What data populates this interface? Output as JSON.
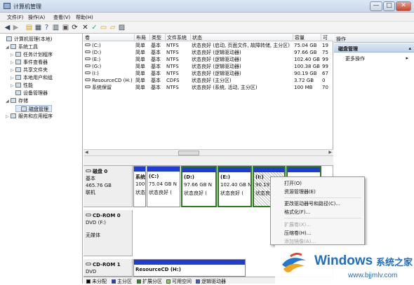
{
  "window": {
    "title": "计算机管理",
    "min": "—",
    "max": "□",
    "close": "✕"
  },
  "menu": [
    "文件(F)",
    "操作(A)",
    "查看(V)",
    "帮助(H)"
  ],
  "tree": [
    {
      "label": "计算机管理(本地)",
      "toggle": ""
    },
    {
      "label": "系统工具",
      "toggle": "◢"
    },
    {
      "label": "任务计划程序",
      "toggle": "▷"
    },
    {
      "label": "事件查看器",
      "toggle": "▷"
    },
    {
      "label": "共享文件夹",
      "toggle": "▷"
    },
    {
      "label": "本地用户和组",
      "toggle": "▷"
    },
    {
      "label": "性能",
      "toggle": "▷"
    },
    {
      "label": "设备管理器",
      "toggle": ""
    },
    {
      "label": "存储",
      "toggle": "◢"
    },
    {
      "label": "磁盘管理",
      "toggle": ""
    },
    {
      "label": "服务和应用程序",
      "toggle": "▷"
    }
  ],
  "volumes": {
    "headers": [
      "卷",
      "布局",
      "类型",
      "文件系统",
      "状态",
      "容量",
      "可"
    ],
    "rows": [
      [
        "(C:)",
        "简单",
        "基本",
        "NTFS",
        "状态良好 (启动, 页面文件, 故障转储, 主分区)",
        "75.04 GB",
        "19"
      ],
      [
        "(D:)",
        "简单",
        "基本",
        "NTFS",
        "状态良好 (逻辑驱动器)",
        "97.66 GB",
        "75"
      ],
      [
        "(E:)",
        "简单",
        "基本",
        "NTFS",
        "状态良好 (逻辑驱动器)",
        "102.40 GB",
        "99"
      ],
      [
        "(G:)",
        "简单",
        "基本",
        "NTFS",
        "状态良好 (逻辑驱动器)",
        "100.38 GB",
        "99"
      ],
      [
        "(I:)",
        "简单",
        "基本",
        "NTFS",
        "状态良好 (逻辑驱动器)",
        "90.19 GB",
        "67"
      ],
      [
        "ResourceCD (H:)",
        "简单",
        "基本",
        "CDFS",
        "状态良好 (主分区)",
        "3.72 GB",
        "0"
      ],
      [
        "系统保留",
        "简单",
        "基本",
        "NTFS",
        "状态良好 (系统, 活动, 主分区)",
        "100 MB",
        "70"
      ]
    ]
  },
  "disk0": {
    "title": "磁盘 0",
    "type": "基本",
    "size": "465.76 GB",
    "status": "联机",
    "parts": [
      {
        "name": "系统",
        "size": "100",
        "state": "状态"
      },
      {
        "name": "(C:)",
        "size": "75.04 GB N",
        "state": "状态良好 ("
      },
      {
        "name": "(D:)",
        "size": "97.66 GB N",
        "state": "状态良好 ("
      },
      {
        "name": "(E:)",
        "size": "102.40 GB N",
        "state": "状态良好 ("
      },
      {
        "name": "(I:)",
        "size": "90.19",
        "state": "状态良"
      },
      {
        "name": "",
        "size": "",
        "state": ""
      }
    ]
  },
  "cdrom0": {
    "title": "CD-ROM 0",
    "line1": "DVD (F:)",
    "line2": "",
    "line3": "无媒体"
  },
  "cdrom1": {
    "title": "CD-ROM 1",
    "line1": "DVD",
    "part_name": "ResourceCD (H:)"
  },
  "legend": [
    "未分配",
    "主分区",
    "扩展分区",
    "可用空间",
    "逻辑驱动器"
  ],
  "legend_colors": [
    "#000000",
    "#1e3cd6",
    "#2e8b22",
    "#8fd14f",
    "#3a5bd9"
  ],
  "actions": {
    "header": "操作",
    "section": "磁盘管理",
    "more": "更多操作",
    "more_arrow": "▸",
    "section_arrow": "▴"
  },
  "context_menu": [
    {
      "label": "打开(O)",
      "disabled": false
    },
    {
      "label": "资源管理器(E)",
      "disabled": false
    },
    {
      "label": "更改驱动器号和路径(C)...",
      "disabled": false
    },
    {
      "label": "格式化(F)...",
      "disabled": false
    },
    {
      "label": "扩展卷(X)...",
      "disabled": true
    },
    {
      "label": "压缩卷(H)...",
      "disabled": false
    },
    {
      "label": "添加镜像(A)...",
      "disabled": true
    }
  ],
  "watermark": {
    "brand": "Windows",
    "cn": "系统之家",
    "url": "www.bjjmlv.com"
  }
}
